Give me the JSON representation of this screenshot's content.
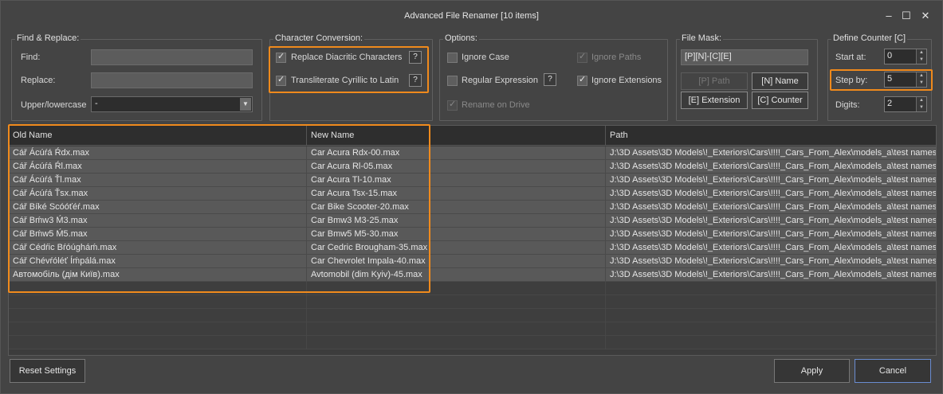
{
  "window": {
    "title": "Advanced File Renamer [10 items]",
    "minimize": "–",
    "maximize": "☐",
    "close": "✕"
  },
  "find_replace": {
    "title": "Find & Replace:",
    "find_label": "Find:",
    "find_value": "",
    "replace_label": "Replace:",
    "replace_value": "",
    "case_label": "Upper/lowercase",
    "case_value": "-"
  },
  "char_conv": {
    "title": "Character Conversion:",
    "diacritic_label": "Replace Diacritic Characters",
    "diacritic_checked": true,
    "cyrillic_label": "Transliterate Cyrillic to Latin",
    "cyrillic_checked": true,
    "help": "?"
  },
  "options": {
    "title": "Options:",
    "ignore_case": "Ignore Case",
    "regex": "Regular Expression",
    "rename_drive": "Rename on Drive",
    "ignore_paths": "Ignore Paths",
    "ignore_ext": "Ignore Extensions",
    "help": "?"
  },
  "file_mask": {
    "title": "File Mask:",
    "value": "[P][N]-[C][E]",
    "path_btn": "[P] Path",
    "name_btn": "[N] Name",
    "ext_btn": "[E] Extension",
    "counter_btn": "[C] Counter"
  },
  "counter": {
    "title": "Define Counter [C]",
    "start_label": "Start at:",
    "start_value": "0",
    "step_label": "Step by:",
    "step_value": "5",
    "digits_label": "Digits:",
    "digits_value": "2"
  },
  "grid": {
    "columns": [
      "Old Name",
      "New Name",
      "Path"
    ],
    "rows": [
      [
        "Cář Ácúŕá Ŕdx.max",
        "Car Acura Rdx-00.max",
        "J:\\3D Assets\\3D Models\\!_Exteriors\\Cars\\!!!!_Cars_From_Alex\\models_a\\test names"
      ],
      [
        "Cář Ácúŕá Ŕl.max",
        "Car Acura Rl-05.max",
        "J:\\3D Assets\\3D Models\\!_Exteriors\\Cars\\!!!!_Cars_From_Alex\\models_a\\test names"
      ],
      [
        "Cář Ácúŕá Ťl.max",
        "Car Acura Tl-10.max",
        "J:\\3D Assets\\3D Models\\!_Exteriors\\Cars\\!!!!_Cars_From_Alex\\models_a\\test names"
      ],
      [
        "Cář Ácúŕá Ťsx.max",
        "Car Acura Tsx-15.max",
        "J:\\3D Assets\\3D Models\\!_Exteriors\\Cars\\!!!!_Cars_From_Alex\\models_a\\test names"
      ],
      [
        "Cář Bíké Scóóťéŕ.max",
        "Car Bike Scooter-20.max",
        "J:\\3D Assets\\3D Models\\!_Exteriors\\Cars\\!!!!_Cars_From_Alex\\models_a\\test names"
      ],
      [
        "Cář Bḿw3 Ḿ3.max",
        "Car Bmw3 M3-25.max",
        "J:\\3D Assets\\3D Models\\!_Exteriors\\Cars\\!!!!_Cars_From_Alex\\models_a\\test names"
      ],
      [
        "Cář Bḿw5 Ḿ5.max",
        "Car Bmw5 M5-30.max",
        "J:\\3D Assets\\3D Models\\!_Exteriors\\Cars\\!!!!_Cars_From_Alex\\models_a\\test names"
      ],
      [
        "Cář Cédŕic Bŕóúgháḿ.max",
        "Car Cedric Brougham-35.max",
        "J:\\3D Assets\\3D Models\\!_Exteriors\\Cars\\!!!!_Cars_From_Alex\\models_a\\test names"
      ],
      [
        "Cář Chévŕóléť Íḿpálá.max",
        "Car Chevrolet Impala-40.max",
        "J:\\3D Assets\\3D Models\\!_Exteriors\\Cars\\!!!!_Cars_From_Alex\\models_a\\test names"
      ],
      [
        "Автомобіль (дім Київ).max",
        "Avtomobil (dim Kyiv)-45.max",
        "J:\\3D Assets\\3D Models\\!_Exteriors\\Cars\\!!!!_Cars_From_Alex\\models_a\\test names"
      ]
    ]
  },
  "footer": {
    "reset": "Reset Settings",
    "apply": "Apply",
    "cancel": "Cancel"
  },
  "colors": {
    "highlight": "#f08a1c",
    "background": "#444444"
  }
}
